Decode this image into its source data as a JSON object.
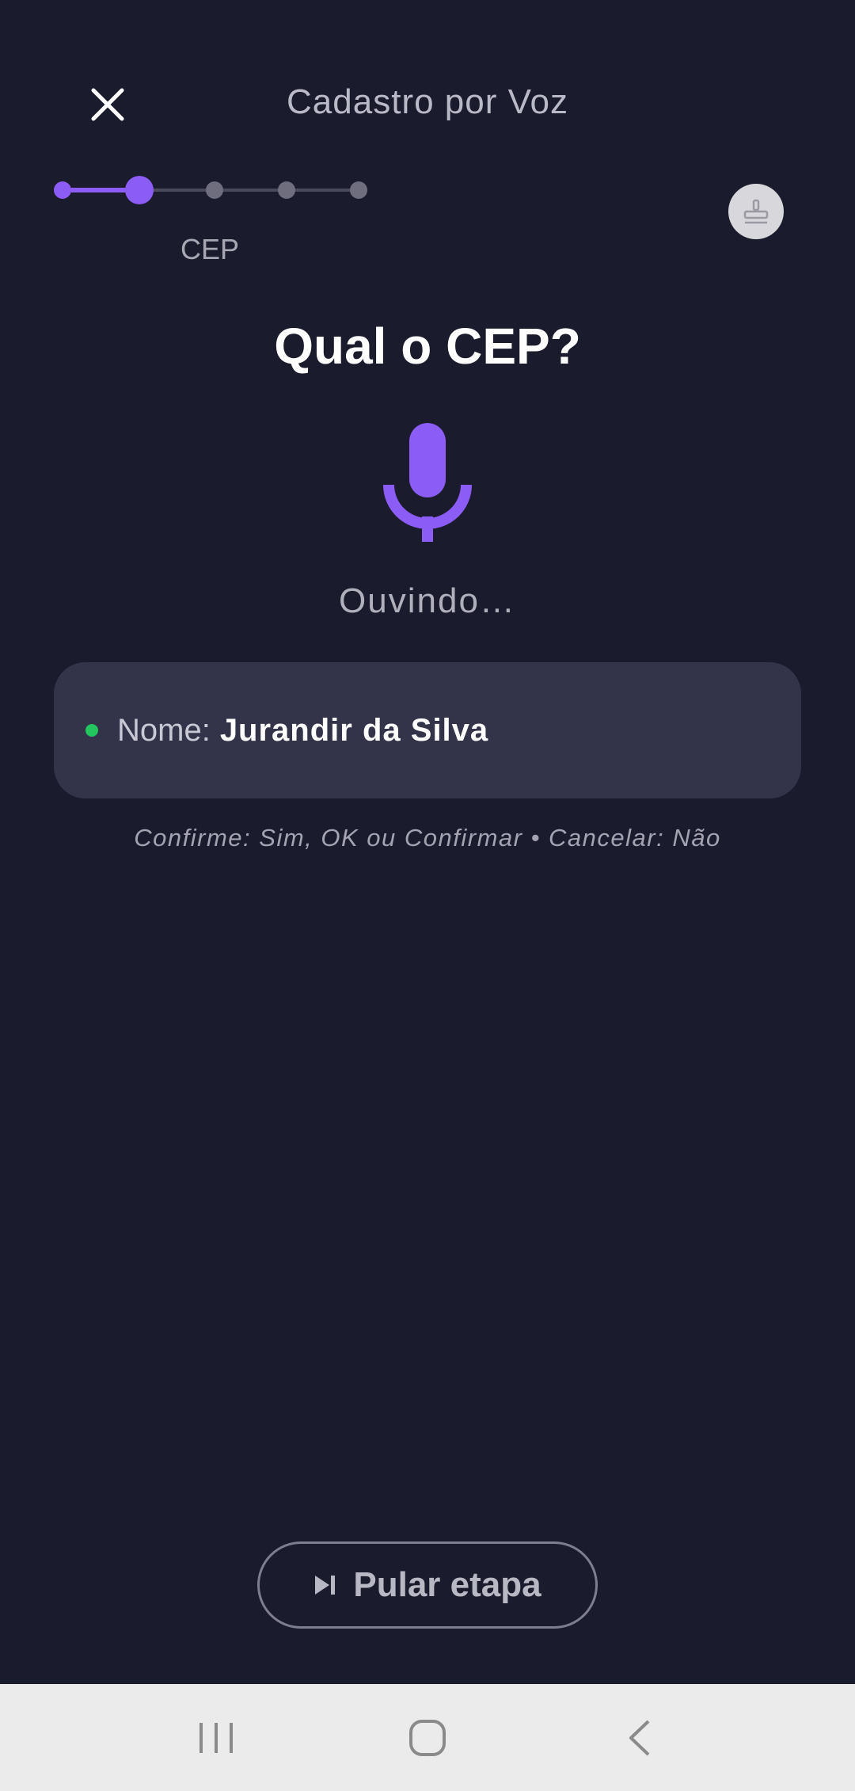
{
  "header": {
    "title": "Cadastro por Voz",
    "close_icon": "close-icon"
  },
  "stepper": {
    "total_steps": 5,
    "current_step": 2,
    "current_label": "CEP"
  },
  "profile": {
    "icon": "stamp-icon"
  },
  "main": {
    "question": "Qual o CEP?",
    "mic_icon": "microphone-icon",
    "status": "Ouvindo…"
  },
  "collected": {
    "label": "Nome:",
    "value": "Jurandir da Silva"
  },
  "hint": "Confirme: Sim, OK ou Confirmar • Cancelar: Não",
  "skip": {
    "label": "Pular etapa",
    "icon": "skip-next-icon"
  },
  "system_nav": {
    "recents_icon": "recents-icon",
    "home_icon": "home-icon",
    "back_icon": "back-icon"
  },
  "colors": {
    "background": "#1b1b2e",
    "accent": "#8b5cf6",
    "card": "#33334a",
    "success": "#22c55e"
  }
}
